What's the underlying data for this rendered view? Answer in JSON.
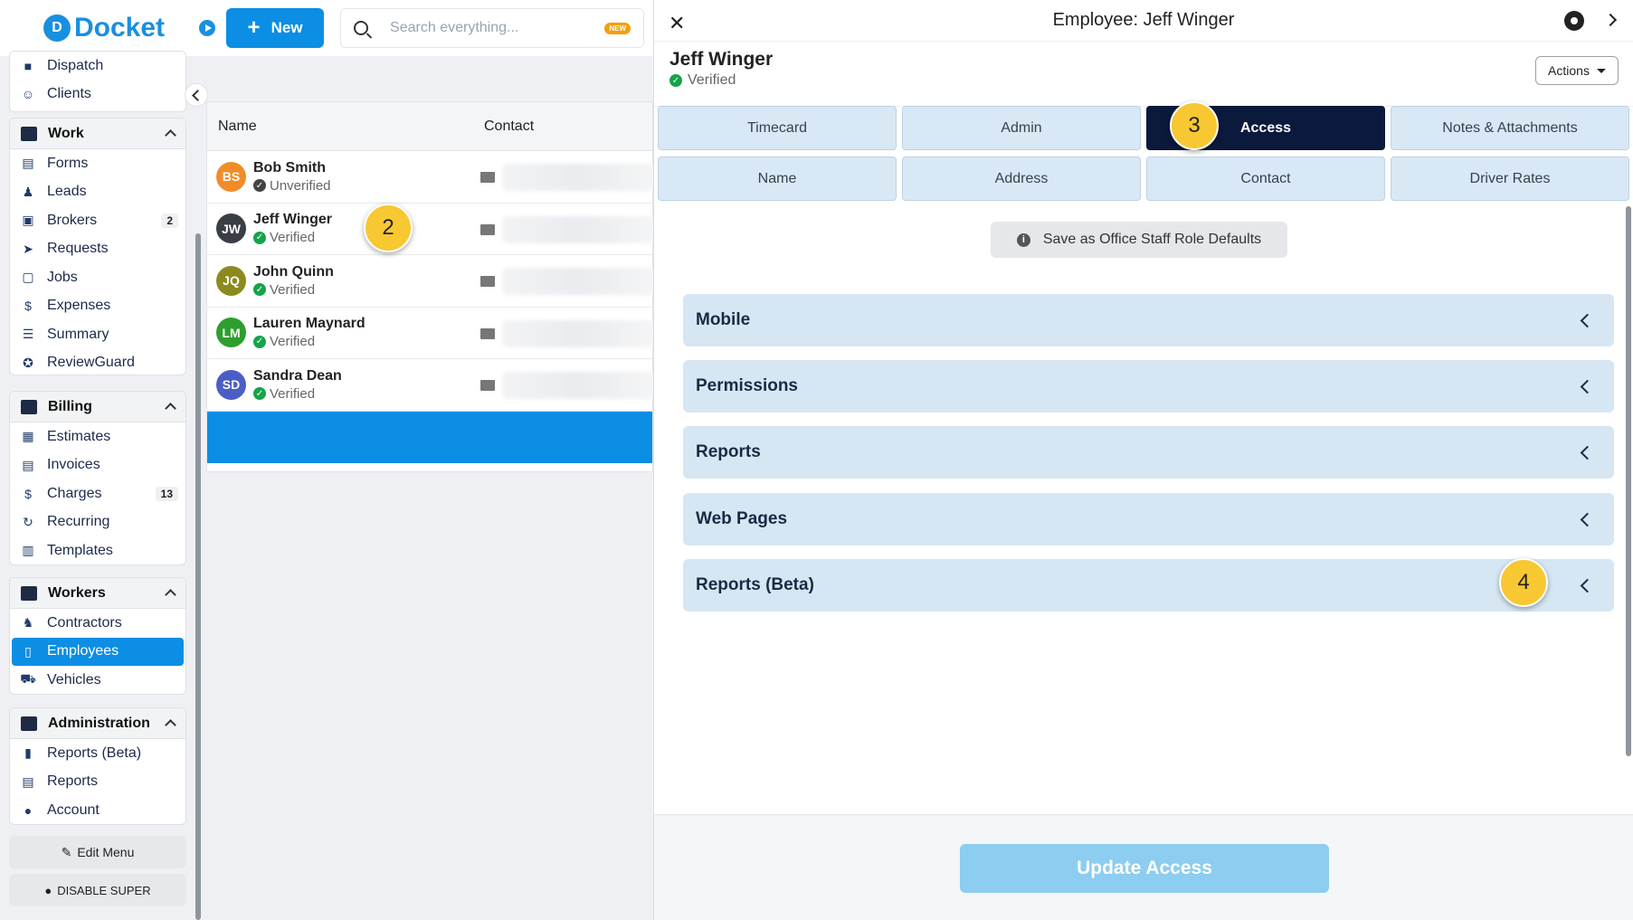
{
  "app": {
    "logo": "Docket"
  },
  "topbar": {
    "new_label": "New",
    "search_placeholder": "Search everything...",
    "search_badge": "NEW"
  },
  "sidebar": {
    "top_items": [
      {
        "label": "Dispatch",
        "icon": "truck-icon"
      },
      {
        "label": "Clients",
        "icon": "users-icon"
      }
    ],
    "sections": [
      {
        "title": "Work",
        "items": [
          {
            "label": "Forms",
            "icon": "form-icon"
          },
          {
            "label": "Leads",
            "icon": "user-search-icon"
          },
          {
            "label": "Brokers",
            "icon": "briefcase-icon",
            "count": "2"
          },
          {
            "label": "Requests",
            "icon": "send-icon"
          },
          {
            "label": "Jobs",
            "icon": "clipboard-icon"
          },
          {
            "label": "Expenses",
            "icon": "dollar-circle-icon"
          },
          {
            "label": "Summary",
            "icon": "list-icon"
          },
          {
            "label": "ReviewGuard",
            "icon": "star-badge-icon"
          }
        ]
      },
      {
        "title": "Billing",
        "items": [
          {
            "label": "Estimates",
            "icon": "calculator-icon"
          },
          {
            "label": "Invoices",
            "icon": "invoice-icon"
          },
          {
            "label": "Charges",
            "icon": "dollar-icon",
            "count": "13"
          },
          {
            "label": "Recurring",
            "icon": "refresh-icon"
          },
          {
            "label": "Templates",
            "icon": "template-icon"
          }
        ]
      },
      {
        "title": "Workers",
        "items": [
          {
            "label": "Contractors",
            "icon": "contractor-icon"
          },
          {
            "label": "Employees",
            "icon": "id-badge-icon",
            "active": true
          },
          {
            "label": "Vehicles",
            "icon": "vehicle-icon"
          }
        ]
      },
      {
        "title": "Administration",
        "items": [
          {
            "label": "Reports (Beta)",
            "icon": "chart-icon"
          },
          {
            "label": "Reports",
            "icon": "report-icon"
          },
          {
            "label": "Account",
            "icon": "account-icon"
          }
        ]
      }
    ],
    "edit_menu_label": "Edit Menu",
    "disable_super_label": "DISABLE SUPER"
  },
  "list": {
    "columns": [
      "Name",
      "Contact"
    ],
    "rows": [
      {
        "initials": "BS",
        "name": "Bob Smith",
        "status": "Unverified",
        "color": "#f28c28"
      },
      {
        "initials": "JW",
        "name": "Jeff Winger",
        "status": "Verified",
        "color": "#3b3f45"
      },
      {
        "initials": "JQ",
        "name": "John Quinn",
        "status": "Verified",
        "color": "#8c8a1e"
      },
      {
        "initials": "LM",
        "name": "Lauren Maynard",
        "status": "Verified",
        "color": "#2e9e2e"
      },
      {
        "initials": "SD",
        "name": "Sandra Dean",
        "status": "Verified",
        "color": "#4a5ec6"
      }
    ]
  },
  "steps": {
    "two": "2",
    "three": "3",
    "four": "4"
  },
  "panel": {
    "title": "Employee: Jeff Winger",
    "employee_name": "Jeff Winger",
    "employee_status": "Verified",
    "actions_label": "Actions",
    "tabs": [
      "Timecard",
      "Admin",
      "Access",
      "Notes & Attachments",
      "Name",
      "Address",
      "Contact",
      "Driver Rates"
    ],
    "active_tab": "Access",
    "defaults_label": "Save as Office Staff Role Defaults",
    "accordions": [
      "Mobile",
      "Permissions",
      "Reports",
      "Web Pages",
      "Reports (Beta)"
    ],
    "update_label": "Update Access"
  },
  "colors": {
    "accent": "#0b8ee4",
    "active_tab": "#0b1a3c",
    "step_bubble": "#f7c832"
  }
}
